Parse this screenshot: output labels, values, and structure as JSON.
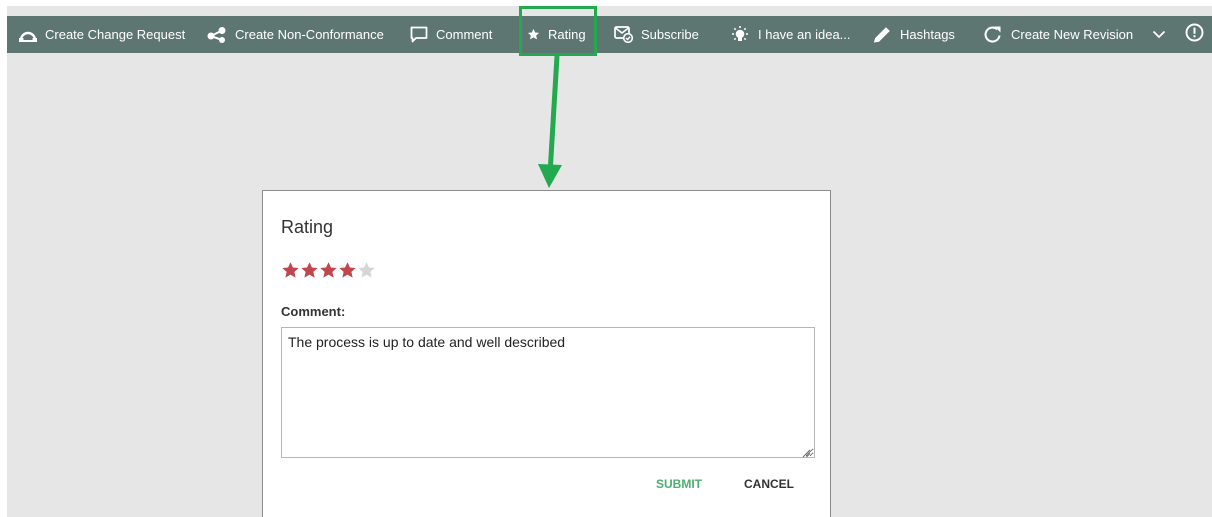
{
  "toolbar": {
    "items": [
      {
        "label": "Create Change Request",
        "icon": "change-request-icon"
      },
      {
        "label": "Create Non-Conformance",
        "icon": "share-nodes-icon"
      },
      {
        "label": "Comment",
        "icon": "comment-icon"
      },
      {
        "label": "Rating",
        "icon": "star-icon"
      },
      {
        "label": "Subscribe",
        "icon": "subscribe-icon"
      },
      {
        "label": "I have an idea...",
        "icon": "lightbulb-icon"
      },
      {
        "label": "Hashtags",
        "icon": "pencil-icon"
      },
      {
        "label": "Create New Revision",
        "icon": "refresh-icon"
      }
    ],
    "more_icon": "chevron-down-icon",
    "info_icon": "alert-circle-icon"
  },
  "annotation": {
    "highlight_color": "#23a94f",
    "target": "Rating"
  },
  "dialog": {
    "title": "Rating",
    "rating": 4,
    "max_rating": 5,
    "star_color": "#c0474e",
    "star_empty_color": "#d6d6d6",
    "comment_label": "Comment:",
    "comment_value": "The process is up to date and well described",
    "submit_label": "SUBMIT",
    "cancel_label": "CANCEL"
  },
  "colors": {
    "toolbar_bg": "#5d7671",
    "page_bg": "#e6e6e6",
    "submit": "#4caf6e"
  }
}
